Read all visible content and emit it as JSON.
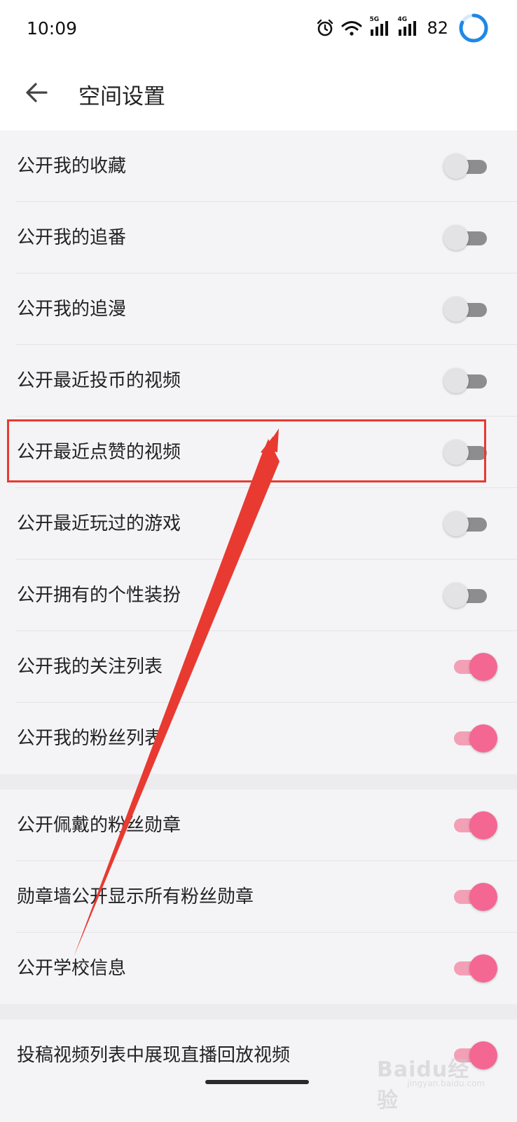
{
  "status_bar": {
    "time": "10:09",
    "signal_1_label": "5G",
    "signal_2_label": "4G",
    "battery": "82"
  },
  "header": {
    "title": "空间设置"
  },
  "settings": [
    {
      "label": "公开我的收藏",
      "on": false
    },
    {
      "label": "公开我的追番",
      "on": false
    },
    {
      "label": "公开我的追漫",
      "on": false
    },
    {
      "label": "公开最近投币的视频",
      "on": false
    },
    {
      "label": "公开最近点赞的视频",
      "on": false
    },
    {
      "label": "公开最近玩过的游戏",
      "on": false
    },
    {
      "label": "公开拥有的个性装扮",
      "on": false
    },
    {
      "label": "公开我的关注列表",
      "on": true
    },
    {
      "label": "公开我的粉丝列表",
      "on": true
    },
    {
      "label": "公开佩戴的粉丝勋章",
      "on": true
    },
    {
      "label": "勋章墙公开显示所有粉丝勋章",
      "on": true
    },
    {
      "label": "公开学校信息",
      "on": true
    },
    {
      "label": "投稿视频列表中展现直播回放视频",
      "on": true
    }
  ],
  "colors": {
    "toggle_on": "#f46793",
    "toggle_on_track": "#f3a0b6",
    "toggle_off_track": "#8d8d8f",
    "highlight": "#e83a31",
    "battery_ring": "#1e88e5"
  },
  "watermark": {
    "main": "Baidu经验",
    "sub": "jingyan.baidu.com"
  }
}
